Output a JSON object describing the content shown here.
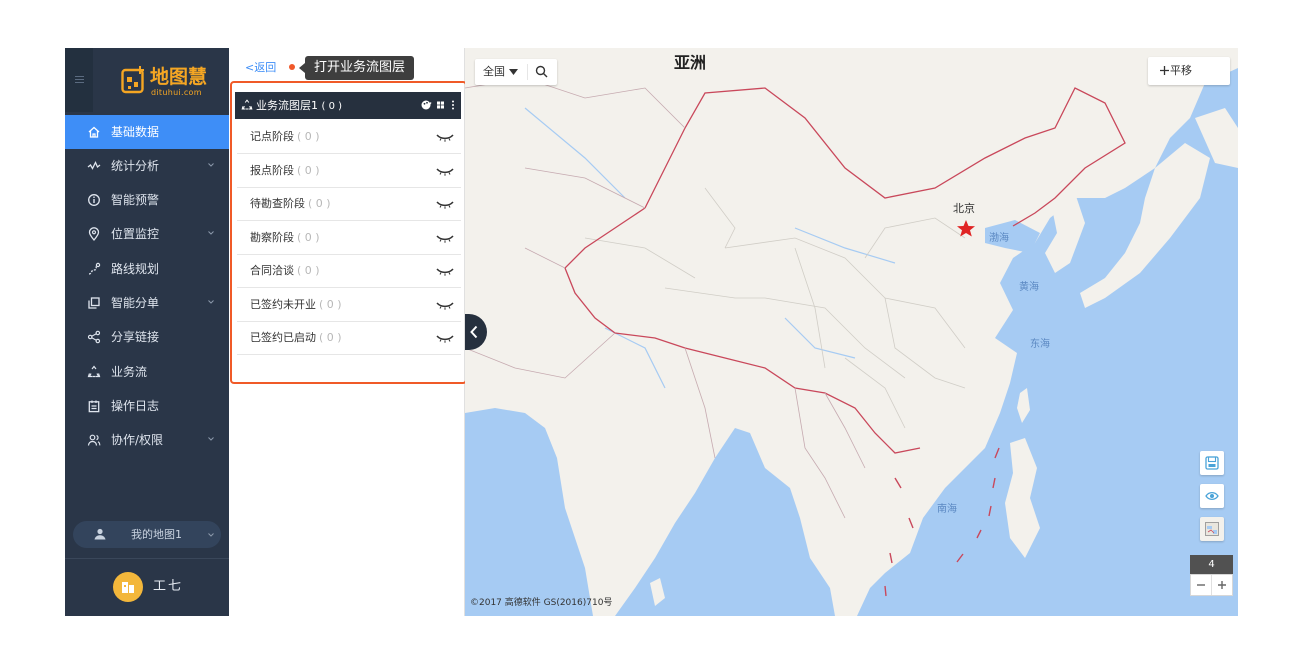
{
  "brand": {
    "name_cn": "地图慧",
    "name_en": "dituhui.com",
    "color": "#f5a623"
  },
  "nav": {
    "items": [
      {
        "label": "基础数据",
        "icon": "home-icon",
        "active": true,
        "has_sub": false
      },
      {
        "label": "统计分析",
        "icon": "line-chart-icon",
        "active": false,
        "has_sub": true
      },
      {
        "label": "智能预警",
        "icon": "info-icon",
        "active": false,
        "has_sub": false
      },
      {
        "label": "位置监控",
        "icon": "location-pin-icon",
        "active": false,
        "has_sub": true
      },
      {
        "label": "路线规划",
        "icon": "route-icon",
        "active": false,
        "has_sub": false
      },
      {
        "label": "智能分单",
        "icon": "copy-icon",
        "active": false,
        "has_sub": true
      },
      {
        "label": "分享链接",
        "icon": "share-icon",
        "active": false,
        "has_sub": false
      },
      {
        "label": "业务流",
        "icon": "recycle-icon",
        "active": false,
        "has_sub": false
      },
      {
        "label": "操作日志",
        "icon": "calendar-icon",
        "active": false,
        "has_sub": false
      },
      {
        "label": "协作/权限",
        "icon": "users-icon",
        "active": false,
        "has_sub": true
      }
    ],
    "active_color": "#3e8ef7"
  },
  "my_map": {
    "label": "我的地图1",
    "icon": "map-user-icon"
  },
  "user": {
    "name": "工七"
  },
  "panel": {
    "back_label": "<返回",
    "tooltip": "打开业务流图层",
    "highlight_color": "#f05a28",
    "layer": {
      "title": "业务流图层1",
      "count": "( 0 )"
    },
    "stages": [
      {
        "name": "记点阶段",
        "count": "( 0 )"
      },
      {
        "name": "报点阶段",
        "count": "( 0 )"
      },
      {
        "name": "待勘查阶段",
        "count": "( 0 )"
      },
      {
        "name": "勘察阶段",
        "count": "( 0 )"
      },
      {
        "name": "合同洽谈",
        "count": "( 0 )"
      },
      {
        "name": "已签约未开业",
        "count": "( 0 )"
      },
      {
        "name": "已签约已启动",
        "count": "( 0 )"
      }
    ]
  },
  "map": {
    "region_select": "全国",
    "pan_label": "平移",
    "zoom_level": "4",
    "copyright": "©2017 高德软件 GS(2016)710号",
    "labels": {
      "continent": "亚洲",
      "capital": "北京",
      "bohai": "渤海",
      "yellow_sea": "黄海",
      "east_sea": "东海",
      "south_sea": "南海"
    },
    "colors": {
      "water": "#a6cbf3",
      "land": "#f3f1ec",
      "border": "#c9485b"
    }
  }
}
